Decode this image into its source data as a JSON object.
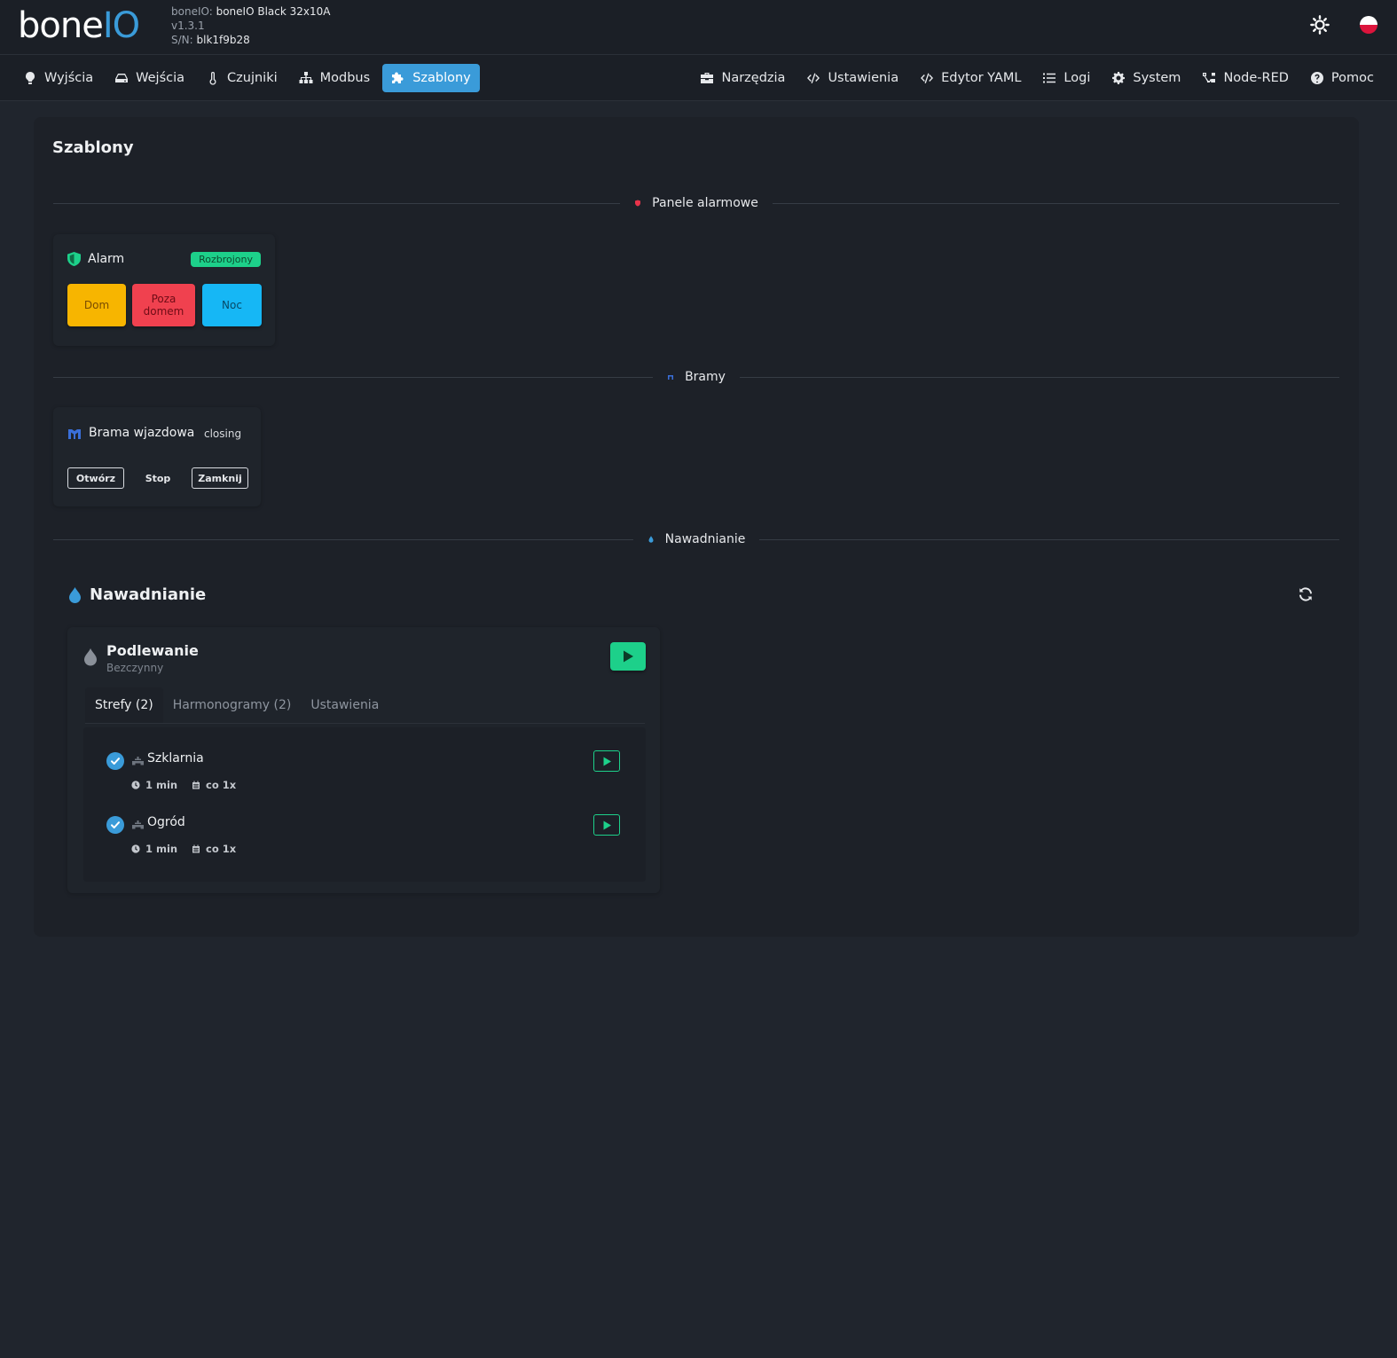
{
  "header": {
    "logo": {
      "part1": "bone",
      "part2": "IO"
    },
    "device": {
      "name_label": "boneIO:",
      "name_value": "boneIO Black 32x10A",
      "version": "v1.3.1",
      "serial_label": "S/N:",
      "serial_value": "blk1f9b28"
    },
    "theme_icon": "sun-icon",
    "language_icon": "poland-flag-icon"
  },
  "nav": {
    "left": [
      {
        "label": "Wyjścia",
        "icon": "lightbulb-icon"
      },
      {
        "label": "Wejścia",
        "icon": "hdd-icon"
      },
      {
        "label": "Czujniki",
        "icon": "thermometer-icon"
      },
      {
        "label": "Modbus",
        "icon": "network-icon"
      },
      {
        "label": "Szablony",
        "icon": "puzzle-icon",
        "active": true
      }
    ],
    "right": [
      {
        "label": "Narzędzia",
        "icon": "toolbox-icon"
      },
      {
        "label": "Ustawienia",
        "icon": "code-icon"
      },
      {
        "label": "Edytor YAML",
        "icon": "code-icon"
      },
      {
        "label": "Logi",
        "icon": "list-icon"
      },
      {
        "label": "System",
        "icon": "gear-icon"
      },
      {
        "label": "Node-RED",
        "icon": "nodes-icon"
      },
      {
        "label": "Pomoc",
        "icon": "question-icon"
      }
    ]
  },
  "page": {
    "title": "Szablony"
  },
  "sections": {
    "alarm": "Panele alarmowe",
    "gates": "Bramy",
    "irrigation": "Nawadnianie"
  },
  "alarm_panel": {
    "title": "Alarm",
    "status": "Rozbrojony",
    "buttons": [
      {
        "label": "Dom",
        "color": "#f7b500"
      },
      {
        "label": "Poza domem",
        "color": "#f0414f"
      },
      {
        "label": "Noc",
        "color": "#16b7f5"
      }
    ]
  },
  "gate": {
    "title": "Brama wjazdowa",
    "state": "closing",
    "buttons": [
      "Otwórz",
      "Stop",
      "Zamknij"
    ]
  },
  "irrigation": {
    "heading": "Nawadnianie",
    "program": {
      "title": "Podlewanie",
      "status": "Bezczynny",
      "tabs": [
        "Strefy (2)",
        "Harmonogramy (2)",
        "Ustawienia"
      ],
      "zones": [
        {
          "name": "Szklarnia",
          "duration": "1 min",
          "frequency": "co 1x",
          "enabled": true
        },
        {
          "name": "Ogród",
          "duration": "1 min",
          "frequency": "co 1x",
          "enabled": true
        }
      ]
    }
  },
  "colors": {
    "accent": "#3a9bd9",
    "success": "#1dd08a",
    "alarm_icon": "#e8334a"
  }
}
